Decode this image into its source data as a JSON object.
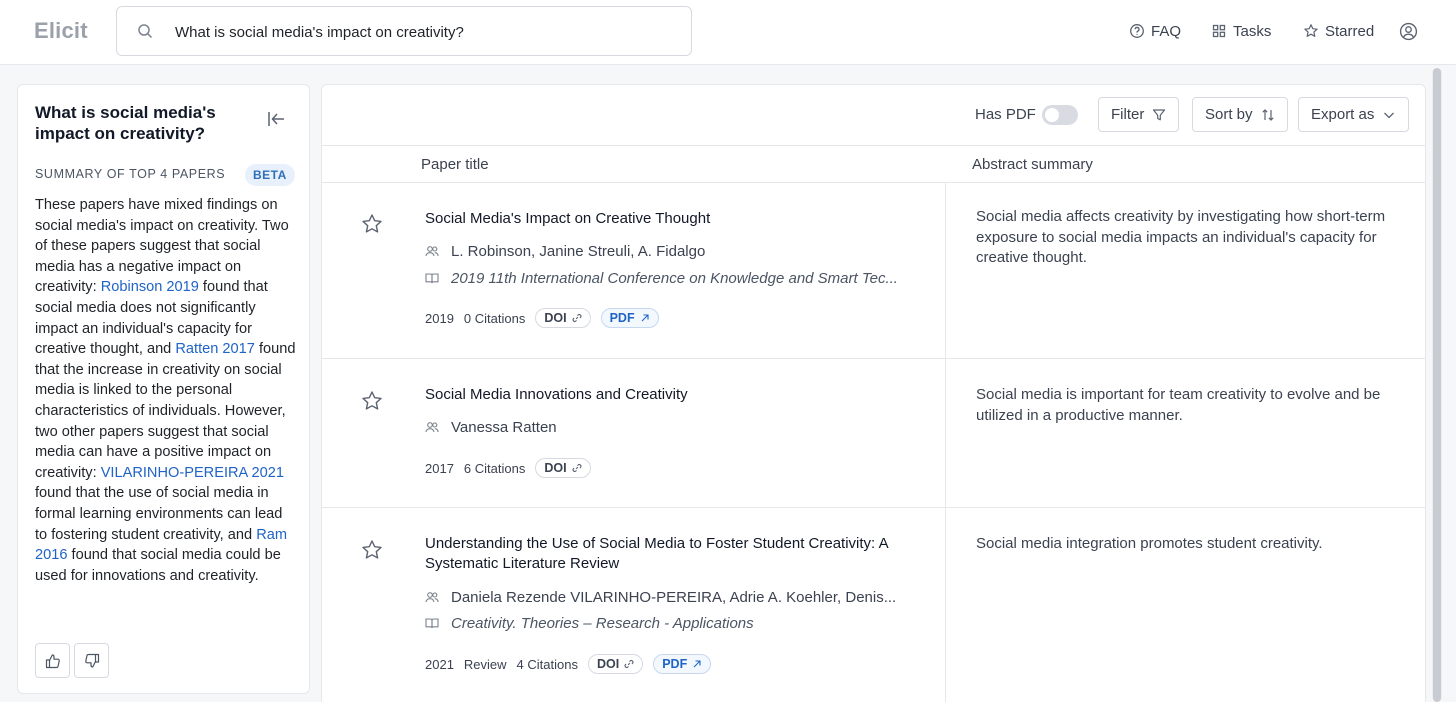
{
  "header": {
    "logo": "Elicit",
    "search_value": "What is social media's impact on creativity?",
    "nav": [
      {
        "label": "FAQ",
        "icon": "help-circle-icon"
      },
      {
        "label": "Tasks",
        "icon": "grid-icon"
      },
      {
        "label": "Starred",
        "icon": "star-icon"
      }
    ],
    "account_icon": "user-circle-icon"
  },
  "summary": {
    "question": "What is social media's impact on creativity?",
    "label": "SUMMARY OF TOP 4 PAPERS",
    "badge": "BETA",
    "segments": [
      {
        "text": "These papers have mixed findings on social media's impact on creativity. Two of these papers suggest that social media has a negative impact on creativity: ",
        "link": false
      },
      {
        "text": "Robinson 2019",
        "link": true
      },
      {
        "text": " found that social media does not significantly impact an individual's capacity for creative thought, and ",
        "link": false
      },
      {
        "text": "Ratten 2017",
        "link": true
      },
      {
        "text": " found that the increase in creativity on social media is linked to the personal characteristics of individuals. However, two other papers suggest that social media can have a positive impact on creativity: ",
        "link": false
      },
      {
        "text": "VILARINHO-PEREIRA 2021",
        "link": true
      },
      {
        "text": " found that the use of social media in formal learning environments can lead to fostering student creativity, and ",
        "link": false
      },
      {
        "text": "Ram 2016",
        "link": true
      },
      {
        "text": " found that social media could be used for innovations and creativity.",
        "link": false
      }
    ]
  },
  "toolbar": {
    "has_pdf_label": "Has PDF",
    "has_pdf_on": false,
    "filter_label": "Filter",
    "sort_label": "Sort by",
    "export_label": "Export as"
  },
  "columns": {
    "title": "Paper title",
    "abstract": "Abstract summary"
  },
  "papers": [
    {
      "title": "Social Media's Impact on Creative Thought",
      "authors": "L. Robinson, Janine Streuli, A. Fidalgo",
      "venue": "2019 11th International Conference on Knowledge and Smart Tec...",
      "year": "2019",
      "type": "",
      "citations": "0 Citations",
      "doi": "DOI",
      "pdf": "PDF",
      "abstract": "Social media affects creativity by investigating how short-term exposure to social media impacts an individual's capacity for creative thought."
    },
    {
      "title": "Social Media Innovations and Creativity",
      "authors": "Vanessa Ratten",
      "venue": "",
      "year": "2017",
      "type": "",
      "citations": "6 Citations",
      "doi": "DOI",
      "pdf": "",
      "abstract": "Social media is important for team creativity to evolve and be utilized in a productive manner."
    },
    {
      "title": "Understanding the Use of Social Media to Foster Student Creativity: A Systematic Literature Review",
      "authors": "Daniela Rezende VILARINHO-PEREIRA, Adrie A. Koehler, Denis...",
      "venue": "Creativity. Theories – Research - Applications",
      "year": "2021",
      "type": "Review",
      "citations": "4 Citations",
      "doi": "DOI",
      "pdf": "PDF",
      "abstract": "Social media integration promotes student creativity."
    }
  ]
}
